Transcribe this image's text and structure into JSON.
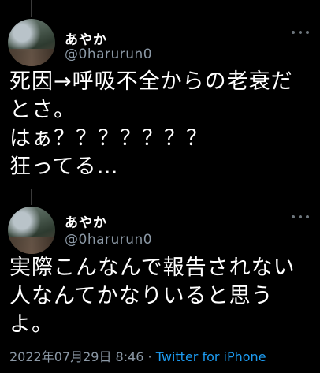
{
  "tweet1": {
    "name": "あやか",
    "handle": "@0harurun0",
    "lines": [
      "死因→呼吸不全からの老衰だ",
      "とさ。",
      "はぁ？？？？？？？",
      "狂ってる…"
    ]
  },
  "tweet2": {
    "name": "あやか",
    "handle": "@0harurun0",
    "lines": [
      "実際こんなんで報告されない",
      "人なんてかなりいると思う",
      "よ。"
    ],
    "timestamp": "2022年07月29日 8:46",
    "separator": " · ",
    "source": "Twitter for iPhone"
  }
}
